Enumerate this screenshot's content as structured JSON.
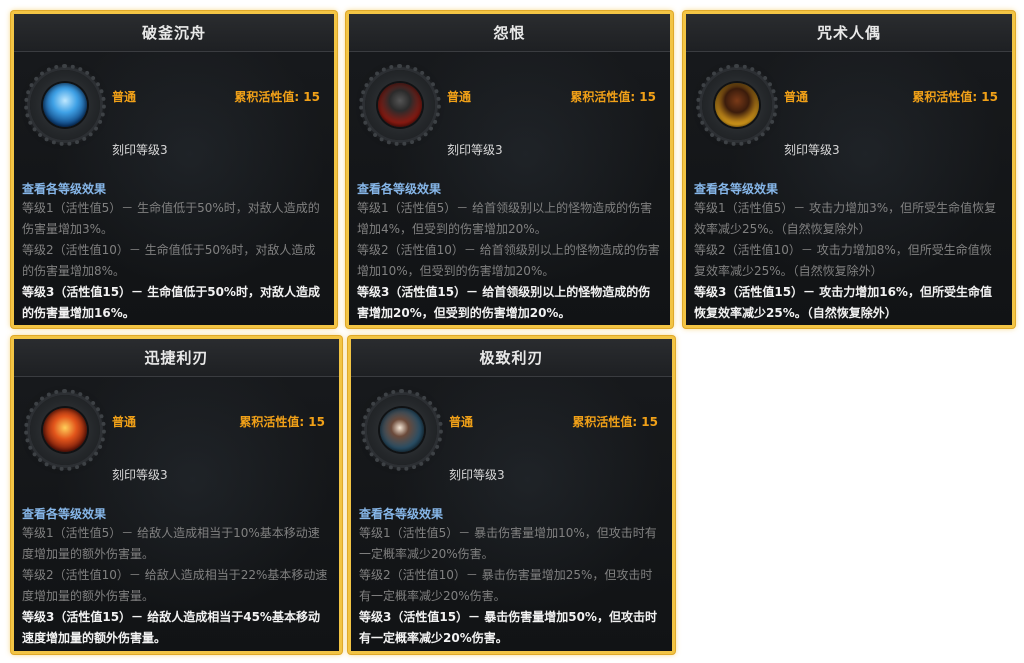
{
  "cards": [
    {
      "title": "破釜沉舟",
      "rarity": "普通",
      "activity": "累积活性值: 15",
      "engrave": "刻印等级3",
      "effects_head": "查看各等级效果",
      "levels": [
        "等级1（活性值5）－ 生命值低于50%时，对敌人造成的伤害量增加3%。",
        "等级2（活性值10）－ 生命值低于50%时，对敌人造成的伤害量增加8%。",
        "等级3（活性值15）－ 生命值低于50%时，对敌人造成的伤害量增加16%。"
      ]
    },
    {
      "title": "怨恨",
      "rarity": "普通",
      "activity": "累积活性值: 15",
      "engrave": "刻印等级3",
      "effects_head": "查看各等级效果",
      "levels": [
        "等级1（活性值5）－ 给首领级别以上的怪物造成的伤害增加4%，但受到的伤害增加20%。",
        "等级2（活性值10）－ 给首领级别以上的怪物造成的伤害增加10%，但受到的伤害增加20%。",
        "等级3（活性值15）－ 给首领级别以上的怪物造成的伤害增加20%，但受到的伤害增加20%。"
      ]
    },
    {
      "title": "咒术人偶",
      "rarity": "普通",
      "activity": "累积活性值: 15",
      "engrave": "刻印等级3",
      "effects_head": "查看各等级效果",
      "levels": [
        "等级1（活性值5）－ 攻击力增加3%，但所受生命值恢复效率减少25%。（自然恢复除外）",
        "等级2（活性值10）－ 攻击力增加8%，但所受生命值恢复效率减少25%。（自然恢复除外）",
        "等级3（活性值15）－ 攻击力增加16%，但所受生命值恢复效率减少25%。（自然恢复除外）"
      ]
    },
    {
      "title": "迅捷利刃",
      "rarity": "普通",
      "activity": "累积活性值: 15",
      "engrave": "刻印等级3",
      "effects_head": "查看各等级效果",
      "levels": [
        "等级1（活性值5）－ 给敌人造成相当于10%基本移动速度增加量的额外伤害量。",
        "等级2（活性值10）－ 给敌人造成相当于22%基本移动速度增加量的额外伤害量。",
        "等级3（活性值15）－ 给敌人造成相当于45%基本移动速度增加量的额外伤害量。"
      ]
    },
    {
      "title": "极致利刃",
      "rarity": "普通",
      "activity": "累积活性值: 15",
      "engrave": "刻印等级3",
      "effects_head": "查看各等级效果",
      "levels": [
        "等级1（活性值5）－ 暴击伤害量增加10%，但攻击时有一定概率减少20%伤害。",
        "等级2（活性值10）－ 暴击伤害量增加25%，但攻击时有一定概率减少20%伤害。",
        "等级3（活性值15）－ 暴击伤害量增加50%，但攻击时有一定概率减少20%伤害。"
      ]
    }
  ],
  "icons": [
    "frost-warrior-icon",
    "werewolf-icon",
    "cursed-doll-icon",
    "flame-figures-icon",
    "spiked-ball-icon"
  ],
  "colors": {
    "frame": "#f2c444",
    "rarity": "#f0a018",
    "effects_head": "#86b6e8"
  }
}
